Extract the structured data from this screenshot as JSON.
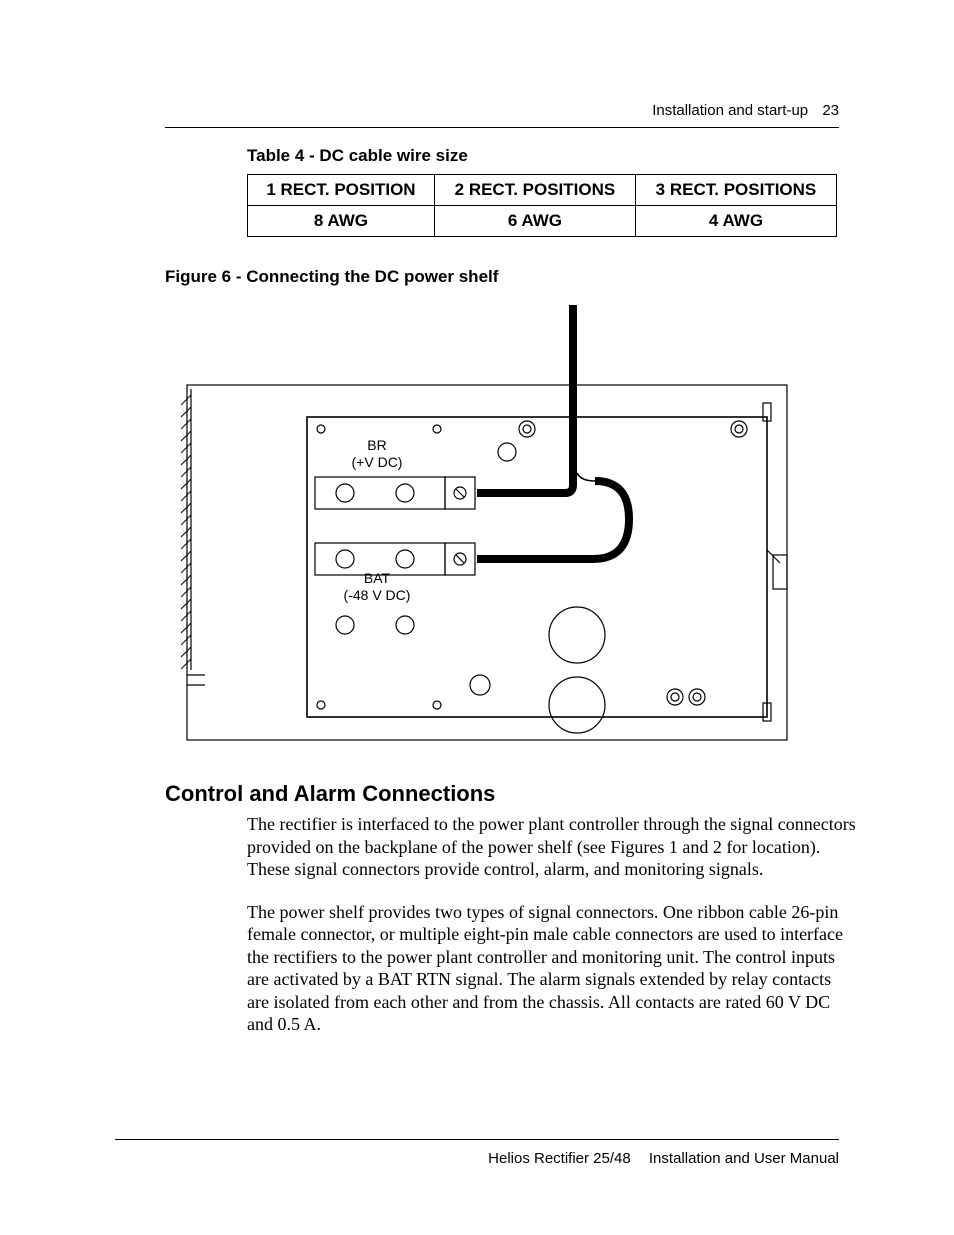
{
  "header": {
    "section_title": "Installation and start-up",
    "page_number": "23"
  },
  "table4": {
    "caption": "Table 4 - DC cable wire size",
    "headers": [
      "1 RECT. POSITION",
      "2 RECT. POSITIONS",
      "3 RECT. POSITIONS"
    ],
    "row": [
      "8 AWG",
      "6 AWG",
      "4 AWG"
    ]
  },
  "figure6": {
    "caption": "Figure 6 - Connecting the DC power shelf",
    "labels": {
      "br": "BR",
      "br_sub": "(+V DC)",
      "bat": "BAT",
      "bat_sub": "(-48 V DC)"
    }
  },
  "section": {
    "heading": "Control and Alarm Connections",
    "para1": "The rectifier is interfaced to the power plant controller through the signal connectors provided on the backplane of the power shelf (see Figures 1 and 2 for location). These signal connectors provide control, alarm, and monitoring signals.",
    "para2": "The power shelf provides two types of signal connectors. One ribbon cable 26-pin female connector, or multiple eight-pin male cable connectors are used to interface the rectifiers to the power plant controller and monitoring unit. The control inputs are activated by a BAT RTN signal. The alarm signals extended by relay contacts are isolated from each other and from the chassis. All contacts are rated 60 V DC and 0.5 A."
  },
  "footer": {
    "left": "Helios Rectifier 25/48",
    "right": "Installation and User Manual"
  }
}
